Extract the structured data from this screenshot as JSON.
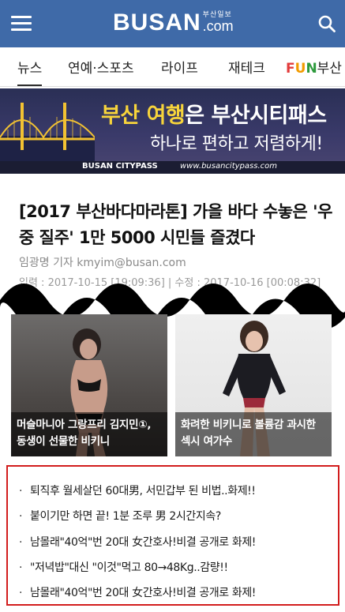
{
  "header": {
    "logo_main": "BUSAN",
    "logo_sub": "부산일보",
    "logo_com": ".com",
    "menu_icon": "hamburger-menu-icon",
    "search_icon": "search-icon",
    "bg_color": "#3f6aa8"
  },
  "nav": {
    "tabs": [
      {
        "label": "뉴스",
        "active": true
      },
      {
        "label": "연예·스포츠"
      },
      {
        "label": "라이프"
      },
      {
        "label": "재테크"
      }
    ],
    "fun_tab": {
      "f1": "F",
      "f2": "U",
      "f3": "N",
      "rest": "부산"
    }
  },
  "banner": {
    "line1_highlight": "부산 여행",
    "line1_rest": "은 부산시티패스",
    "line2": "하나로 편하고 저렴하게!",
    "brand": "BUSAN CITYPASS",
    "url": "www.busancitypass.com"
  },
  "article": {
    "headline": "[2017 부산바다마라톤] 가을 바다 수놓은 '우중 질주' 1만 5000 시민들 즐겼다",
    "byline": "임광명 기자 kmyim@busan.com",
    "dates": "입력 : 2017-10-15 [19:09:36] | 수정 : 2017-10-16 [00:08:32]"
  },
  "thumbnails": [
    {
      "caption": "머슬마니아 그랑프리 김지민①, 동생이 선물한 비키니"
    },
    {
      "caption": "화려한 비키니로 볼륨감 과시한 섹시 여가수"
    }
  ],
  "ad_list": {
    "border_color": "#d21d1d",
    "items": [
      "퇴직후 월세살던 60대男, 서민갑부 된 비법..화제!!",
      "붙이기만 하면 끝! 1분 조루 男 2시간지속?",
      "남몰래\"40억\"번 20대 女간호사!비결 공개로 화제!",
      "\"저녁밥\"대신 \"이것\"먹고 80→48Kg..감량!!",
      "남몰래\"40억\"번 20대 女간호사!비결 공개로 화제!"
    ]
  }
}
